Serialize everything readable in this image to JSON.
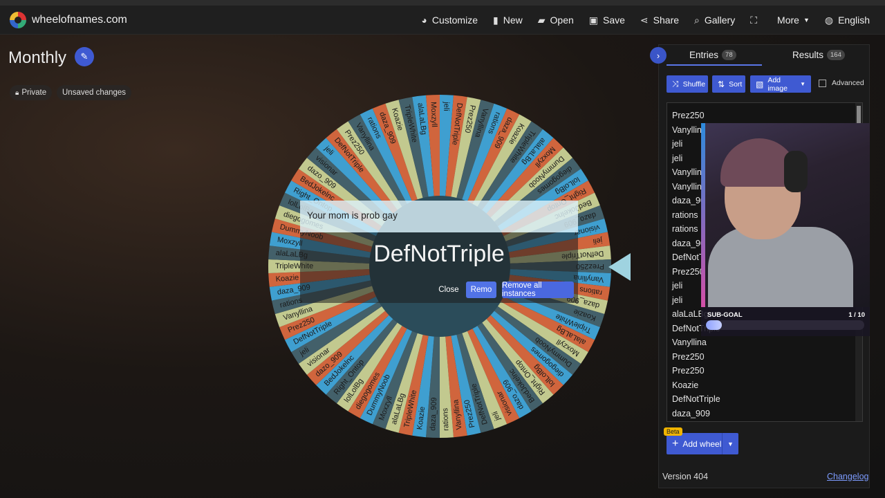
{
  "app": {
    "brand": "wheelofnames.com"
  },
  "menu": [
    {
      "label": "Customize",
      "icon": "palette-icon",
      "glyph": "◕"
    },
    {
      "label": "New",
      "icon": "file-icon",
      "glyph": "▮"
    },
    {
      "label": "Open",
      "icon": "folder-icon",
      "glyph": "▰"
    },
    {
      "label": "Save",
      "icon": "floppy-icon",
      "glyph": "▣"
    },
    {
      "label": "Share",
      "icon": "share-icon",
      "glyph": "⋖"
    },
    {
      "label": "Gallery",
      "icon": "search-icon",
      "glyph": "⌕"
    },
    {
      "label": "",
      "icon": "fullscreen-icon",
      "glyph": "⛶"
    },
    {
      "label": "More",
      "icon": "",
      "glyph": ""
    },
    {
      "label": "English",
      "icon": "globe-icon",
      "glyph": "◍"
    }
  ],
  "wheel_info": {
    "title": "Monthly",
    "private_label": "Private",
    "unsaved_label": "Unsaved changes"
  },
  "wheel": {
    "segment_colors": [
      "#3f9fd0",
      "#d0653d",
      "#c2c98f",
      "#43606a"
    ],
    "labels": [
      "jeli",
      "DefNotTriple",
      "Prez250",
      "Vanyllina",
      "rations",
      "daza_909",
      "Koazie",
      "TripleWhite",
      "alaLaLBg",
      "Moxzyll",
      "DummyNoob",
      "diegogomes",
      "lolLolBg",
      "Right_Ontop",
      "BedJokelnc",
      "dazo_909",
      "visionar"
    ]
  },
  "dialog": {
    "header": "Your mom is prob gay",
    "winner": "DefNotTriple",
    "close_label": "Close",
    "remove_label": "Remo",
    "remove_all_label": "Remove all instances"
  },
  "panel": {
    "entries_tab": "Entries",
    "entries_count": "78",
    "results_tab": "Results",
    "results_count": "164",
    "shuffle_label": "Shuffle",
    "sort_label": "Sort",
    "add_image_label": "Add image",
    "advanced_label": "Advanced",
    "entries": [
      "Prez250",
      "Vanyllina",
      "jeli",
      "jeli",
      "Vanyllina",
      "Vanyllina",
      "daza_909",
      "rations",
      "rations",
      "daza_909",
      "DefNotTriple",
      "Prez250",
      "jeli",
      "jeli",
      "alaLaLBg",
      "DefNotTriple",
      "Vanyllina",
      "Prez250",
      "Prez250",
      "Koazie",
      "DefNotTriple",
      "daza_909"
    ],
    "add_wheel_label": "Add wheel",
    "beta_label": "Beta",
    "version": "Version 404",
    "changelog": "Changelog"
  },
  "overlay": {
    "subgoal_title": "SUB-GOAL",
    "subgoal_count": "1 / 10",
    "subgoal_fraction": 0.1
  }
}
